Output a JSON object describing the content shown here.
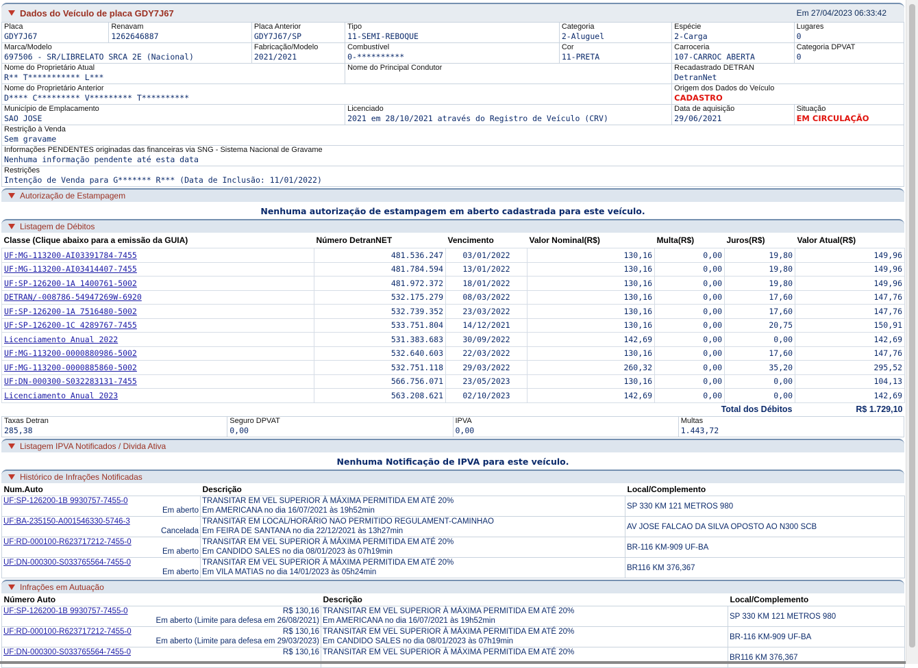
{
  "vehicle": {
    "title": "Dados do Veículo de placa GDY7J67",
    "date": "Em 27/04/2023 06:33:42",
    "row1": [
      {
        "label": "Placa",
        "value": "GDY7J67"
      },
      {
        "label": "Renavam",
        "value": "1262646887"
      },
      {
        "label": "Placa Anterior",
        "value": "GDY7J67/SP"
      },
      {
        "label": "Tipo",
        "value": "11-SEMI-REBOQUE"
      },
      {
        "label": "Categoria",
        "value": "2-Aluguel"
      },
      {
        "label": "Espécie",
        "value": "2-Carga"
      },
      {
        "label": "Lugares",
        "value": "0"
      }
    ],
    "row2": [
      {
        "label": "Marca/Modelo",
        "value": "697506 - SR/LIBRELATO SRCA 2E (Nacional)"
      },
      {
        "label": "Fabricação/Modelo",
        "value": "2021/2021"
      },
      {
        "label": "Combustível",
        "value": "0-**********"
      },
      {
        "label": "Cor",
        "value": "11-PRETA"
      },
      {
        "label": "Carroceria",
        "value": "107-CARROC ABERTA"
      },
      {
        "label": "Categoria DPVAT",
        "value": "0"
      }
    ],
    "row3": [
      {
        "label": "Nome do Proprietário Atual",
        "value": "R** T*********** L***"
      },
      {
        "label": "Nome do Principal Condutor",
        "value": ""
      },
      {
        "label": "Recadastrado DETRAN",
        "value": "DetranNet"
      }
    ],
    "row4": [
      {
        "label": "Nome do Proprietário Anterior",
        "value": "D**** C********* V********* T**********"
      },
      {
        "label": "Origem dos Dados do Veículo",
        "value": "CADASTRO"
      }
    ],
    "row5": [
      {
        "label": "Município de Emplacamento",
        "value": "SAO JOSE"
      },
      {
        "label": "Licenciado",
        "value": "2021 em 28/10/2021 através do Registro de Veículo (CRV)"
      },
      {
        "label": "Data de aquisição",
        "value": "29/06/2021"
      },
      {
        "label": "Situação",
        "value": "EM CIRCULAÇÃO"
      }
    ],
    "restricao": {
      "label": "Restrição à Venda",
      "value": "Sem gravame"
    },
    "pendentes": {
      "label": "Informações PENDENTES originadas das financeiras via SNG - Sistema Nacional de Gravame",
      "value": "Nenhuma informação pendente até esta data"
    },
    "restricoes": {
      "label": "Restrições",
      "value": "Intenção de Venda para G******* R*** (Data de Inclusão: 11/01/2022)"
    },
    "accent_red": "#e0140e"
  },
  "estampagem": {
    "title": "Autorização de Estampagem",
    "message": "Nenhuma autorização de estampagem em aberto cadastrada para este veículo."
  },
  "debitos": {
    "title": "Listagem de Débitos",
    "headers": [
      "Classe (Clique abaixo para a emissão da GUIA)",
      "Número DetranNET",
      "Vencimento",
      "Valor Nominal(R$)",
      "Multa(R$)",
      "Juros(R$)",
      "Valor Atual(R$)"
    ],
    "rows": [
      [
        "UF:MG-113200-AI03391784-7455",
        "481.536.247",
        "03/01/2022",
        "130,16",
        "0,00",
        "19,80",
        "149,96"
      ],
      [
        "UF:MG-113200-AI03414407-7455",
        "481.784.594",
        "13/01/2022",
        "130,16",
        "0,00",
        "19,80",
        "149,96"
      ],
      [
        "UF:SP-126200-1A 1400761-5002",
        "481.972.372",
        "18/01/2022",
        "130,16",
        "0,00",
        "19,80",
        "149,96"
      ],
      [
        "DETRAN/-008786-54947269W-6920",
        "532.175.279",
        "08/03/2022",
        "130,16",
        "0,00",
        "17,60",
        "147,76"
      ],
      [
        "UF:SP-126200-1A 7516480-5002",
        "532.739.352",
        "23/03/2022",
        "130,16",
        "0,00",
        "17,60",
        "147,76"
      ],
      [
        "UF:SP-126200-1C 4289767-7455",
        "533.751.804",
        "14/12/2021",
        "130,16",
        "0,00",
        "20,75",
        "150,91"
      ],
      [
        "Licenciamento Anual 2022",
        "531.383.683",
        "30/09/2022",
        "142,69",
        "0,00",
        "0,00",
        "142,69"
      ],
      [
        "UF:MG-113200-0000880986-5002",
        "532.640.603",
        "22/03/2022",
        "130,16",
        "0,00",
        "17,60",
        "147,76"
      ],
      [
        "UF:MG-113200-0000885860-5002",
        "532.751.118",
        "29/03/2022",
        "260,32",
        "0,00",
        "35,20",
        "295,52"
      ],
      [
        "UF:DN-000300-S032283131-7455",
        "566.756.071",
        "23/05/2023",
        "130,16",
        "0,00",
        "0,00",
        "104,13"
      ],
      [
        "Licenciamento Anual 2023",
        "563.208.621",
        "02/10/2023",
        "142,69",
        "0,00",
        "0,00",
        "142,69"
      ]
    ],
    "total_label": "Total dos Débitos",
    "total_value": "R$ 1.729,10",
    "summary": [
      {
        "label": "Taxas Detran",
        "value": "285,38"
      },
      {
        "label": "Seguro DPVAT",
        "value": "0,00"
      },
      {
        "label": "IPVA",
        "value": "0,00"
      },
      {
        "label": "Multas",
        "value": "1.443,72"
      }
    ]
  },
  "ipva": {
    "title": "Listagem IPVA Notificados / Divida Ativa",
    "message": "Nenhuma Notificação de IPVA para este veículo."
  },
  "historico": {
    "title": "Histórico de Infrações Notificadas",
    "headers": [
      "Num.Auto",
      "Descrição",
      "Local/Complemento"
    ],
    "rows": [
      {
        "auto": "UF:SP-126200-1B 9930757-7455-0",
        "status": "Em aberto",
        "desc1": "TRANSITAR EM VEL SUPERIOR À MÁXIMA PERMITIDA EM ATÉ 20%",
        "desc2": "Em AMERICANA no dia 16/07/2021 às 19h52min",
        "local": "SP 330 KM 121 METROS 980"
      },
      {
        "auto": "UF:BA-235150-A001546330-5746-3",
        "status": "Cancelada",
        "desc1": "TRANSITAR EM LOCAL/HORÁRIO NAO PERMITIDO REGULAMENT-CAMINHAO",
        "desc2": "Em FEIRA DE SANTANA no dia 22/12/2021 às 13h27min",
        "local": "AV JOSE FALCAO DA SILVA OPOSTO AO N300 SCB"
      },
      {
        "auto": "UF:RD-000100-R623717212-7455-0",
        "status": "Em aberto",
        "desc1": "TRANSITAR EM VEL SUPERIOR À MÁXIMA PERMITIDA EM ATÉ 20%",
        "desc2": "Em CANDIDO SALES no dia 08/01/2023 às 07h19min",
        "local": "BR-116 KM-909 UF-BA"
      },
      {
        "auto": "UF:DN-000300-S033765564-7455-0",
        "status": "Em aberto",
        "desc1": "TRANSITAR EM VEL SUPERIOR À MÁXIMA PERMITIDA EM ATÉ 20%",
        "desc2": "Em VILA MATIAS no dia 14/01/2023 às 05h24min",
        "local": "BR116 KM 376,367"
      }
    ]
  },
  "autuacao": {
    "title": "Infrações em Autuação",
    "headers": [
      "Número Auto",
      "Descrição",
      "Local/Complemento"
    ],
    "rows": [
      {
        "auto": "UF:SP-126200-1B 9930757-7455-0",
        "valor": "R$ 130,16",
        "status": "Em aberto (Limite para defesa em 26/08/2021)",
        "desc1": "TRANSITAR EM VEL SUPERIOR À MÁXIMA PERMITIDA EM ATÉ 20%",
        "desc2": "Em AMERICANA no dia 16/07/2021 às 19h52min",
        "local": "SP 330 KM 121 METROS 980"
      },
      {
        "auto": "UF:RD-000100-R623717212-7455-0",
        "valor": "R$ 130,16",
        "status": "Em aberto (Limite para defesa em 29/03/2023)",
        "desc1": "TRANSITAR EM VEL SUPERIOR À MÁXIMA PERMITIDA EM ATÉ 20%",
        "desc2": "Em CANDIDO SALES no dia 08/01/2023 às 07h19min",
        "local": "BR-116 KM-909 UF-BA"
      },
      {
        "auto": "UF:DN-000300-S033765564-7455-0",
        "valor": "R$ 130,16",
        "status": "",
        "desc1": "TRANSITAR EM VEL SUPERIOR À MÁXIMA PERMITIDA EM ATÉ 20%",
        "desc2": "",
        "local": "BR116 KM 376,367"
      }
    ]
  },
  "icons": {
    "section_toggle": "triangle-down-icon"
  }
}
